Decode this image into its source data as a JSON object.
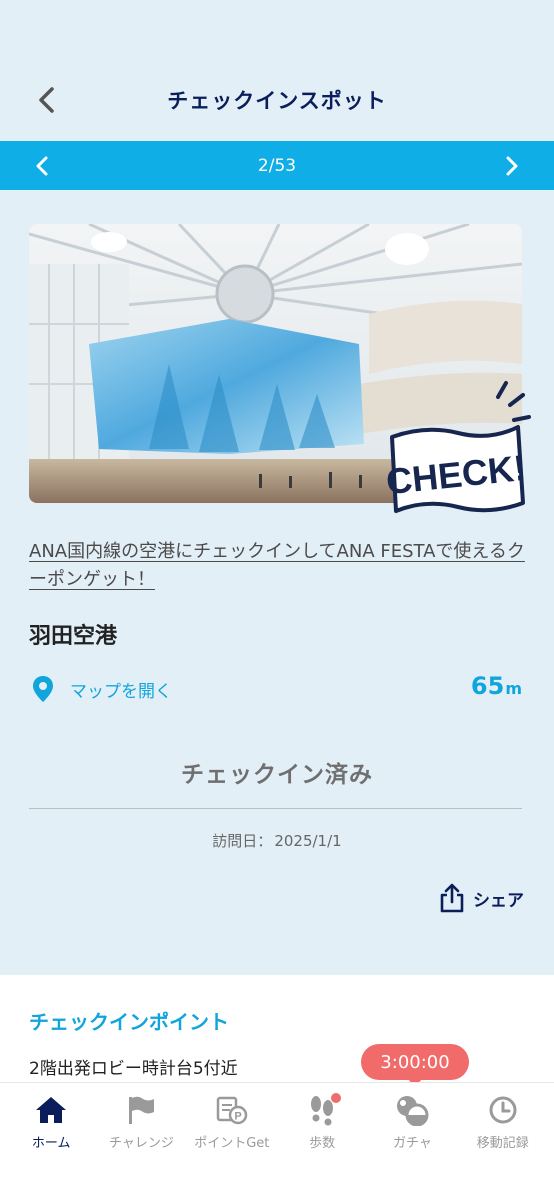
{
  "header": {
    "title": "チェックインスポット"
  },
  "pager": {
    "current": "2",
    "total": "53",
    "text": "2/53"
  },
  "spot": {
    "badge_text": "CHECK!",
    "campaign_link": "ANA国内線の空港にチェックインしてANA FESTAで使えるクーポンゲット！",
    "name": "羽田空港",
    "map_link_label": "マップを開く",
    "distance_value": "65",
    "distance_unit": "m",
    "status": "チェックイン済み",
    "visit_label": "訪問日：",
    "visit_date": "2025/1/1",
    "share_label": "シェア"
  },
  "checkin_point": {
    "title": "チェックインポイント",
    "text": "2階出発ロビー時計台5付近"
  },
  "timer": "3:00:00",
  "tabs": [
    {
      "label": "ホーム",
      "icon": "home-icon",
      "active": true
    },
    {
      "label": "チャレンジ",
      "icon": "flag-icon",
      "active": false
    },
    {
      "label": "ポイントGet",
      "icon": "point-icon",
      "active": false
    },
    {
      "label": "歩数",
      "icon": "footsteps-icon",
      "active": false
    },
    {
      "label": "ガチャ",
      "icon": "gacha-icon",
      "active": false
    },
    {
      "label": "移動記録",
      "icon": "clock-icon",
      "active": false
    }
  ],
  "colors": {
    "background": "#e3eff7",
    "accent_blue": "#10aee6",
    "navy": "#0b1e5b",
    "timer_red": "#f26b6b"
  }
}
